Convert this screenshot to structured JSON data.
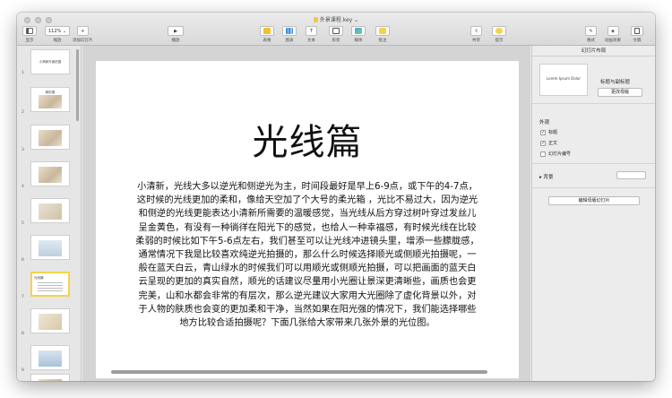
{
  "window": {
    "title": "外景课程.key"
  },
  "toolbar": {
    "view_label": "显示",
    "zoom_value": "112%",
    "zoom_label": "缩放",
    "add_slide_label": "添加幻灯片",
    "play_label": "播放",
    "table_label": "表格",
    "chart_label": "图表",
    "text_label": "文本",
    "shape_label": "形状",
    "media_label": "媒体",
    "comment_label": "批注",
    "share_label": "共享",
    "tips_label": "提示",
    "format_label": "格式",
    "animate_label": "动画效果",
    "document_label": "文稿"
  },
  "navigator": {
    "slides": [
      {
        "num": "1",
        "title": "小清新外景拍摄",
        "type": "title"
      },
      {
        "num": "2",
        "title": "精彩展",
        "type": "photo"
      },
      {
        "num": "3",
        "title": "",
        "type": "photo"
      },
      {
        "num": "4",
        "title": "",
        "type": "photo"
      },
      {
        "num": "5",
        "title": "",
        "type": "photo"
      },
      {
        "num": "6",
        "title": "",
        "type": "photo"
      },
      {
        "num": "7",
        "title": "光线篇",
        "type": "text"
      },
      {
        "num": "8",
        "title": "",
        "type": "photo"
      },
      {
        "num": "9",
        "title": "",
        "type": "photo"
      },
      {
        "num": "10",
        "title": "",
        "type": "photo"
      }
    ]
  },
  "slide": {
    "title": "光线篇",
    "body": "小清新，光线大多以逆光和侧逆光为主，时间段最好是早上6-9点，或下午的4-7点，这时候的光线更加的柔和，像给天空加了个大号的柔光箱 ，光比不易过大，因为逆光和侧逆的光线更能表达小清新所需要的温暖感觉，当光线从后方穿过树叶穿过发丝儿呈金黄色，有没有一种徜徉在阳光下的感觉，也给人一种幸福感，有时候光线在比较柔弱的时候比如下午5-6点左右，我们甚至可以让光线冲进镜头里，增添一些朦胧感，通常情况下我是比较喜欢纯逆光拍摄的，那么什么时候选择顺光或侧顺光拍摄呢，一般在蓝天白云，青山绿水的时候我们可以用顺光或侧顺光拍摄，可以把画面的蓝天白云呈现的更加的真实自然，顺光的话建议尽量用小光圈让景深更清晰些，画质也会更完美，山和水都会非常的有层次，那么逆光建议大家用大光圈除了虚化背景以外，对于人物的肤质也会变的更加柔和干净，当然如果在阳光强的情况下，我们能选择哪些地方比较合适拍摄呢？下面几张给大家带来几张外景的光位图。"
  },
  "inspector": {
    "header": "幻灯片布局",
    "master_thumb_text": "Lorem Ipsum Dolor",
    "master_name": "标题与副标题",
    "change_master": "更改母版",
    "appearance_label": "外观",
    "checkboxes": [
      {
        "label": "标题",
        "checked": "✓"
      },
      {
        "label": "正文",
        "checked": "✓"
      },
      {
        "label": "幻灯片编号",
        "checked": ""
      }
    ],
    "background_label": "背景",
    "edit_master": "编辑母版幻灯片"
  },
  "colors": {
    "selection": "#f3d34a",
    "toolbar_bg": "#dedede"
  }
}
